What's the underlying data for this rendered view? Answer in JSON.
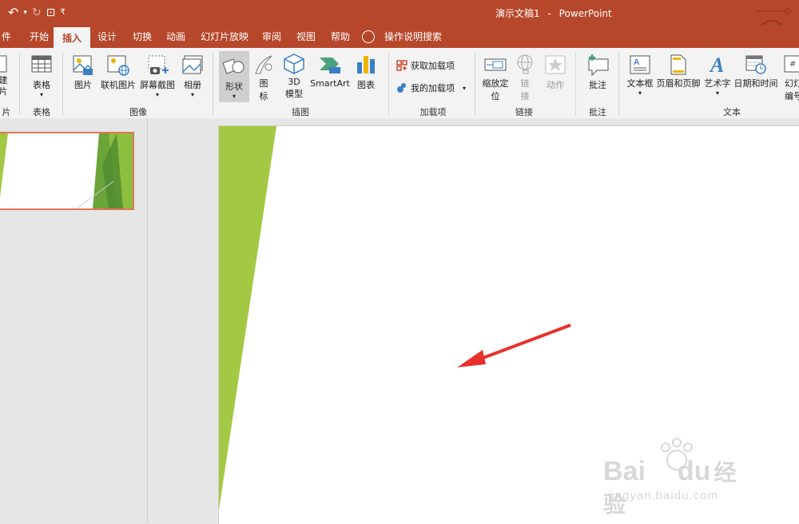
{
  "window": {
    "title": "演示文稿1",
    "app": "PowerPoint",
    "dash": "-"
  },
  "qat": {
    "undo": "↶",
    "undo_arrow": "▾",
    "redo": "↻",
    "present": "⊡",
    "customize": "₹"
  },
  "tabs": [
    {
      "label": "件"
    },
    {
      "label": "开始"
    },
    {
      "label": "插入"
    },
    {
      "label": "设计"
    },
    {
      "label": "切换"
    },
    {
      "label": "动画"
    },
    {
      "label": "幻灯片放映"
    },
    {
      "label": "审阅"
    },
    {
      "label": "视图"
    },
    {
      "label": "帮助"
    },
    {
      "label": "操作说明搜索"
    }
  ],
  "ribbon": {
    "g1": {
      "btn": "建\n片",
      "label": "片"
    },
    "g2": {
      "btn": "表格",
      "label": "表格"
    },
    "g3": {
      "label": "图像",
      "pictures": "图片",
      "online": "联机图片",
      "screenshot": "屏幕截图",
      "album": "相册"
    },
    "g4": {
      "label": "插图",
      "shapes": "形状",
      "icons_1": "图",
      "icons_2": "标",
      "model_1": "3D",
      "model_2": "模型",
      "smartart": "SmartArt",
      "chart": "图表"
    },
    "g5": {
      "label": "加载项",
      "get": "获取加载项",
      "my": "我的加载项"
    },
    "g6": {
      "label": "链接",
      "zoom_1": "缩放定",
      "zoom_2": "位",
      "link_1": "链",
      "link_2": "接",
      "action": "动作"
    },
    "g7": {
      "label": "批注",
      "comment": "批注"
    },
    "g8": {
      "label": "文本",
      "textbox": "文本框",
      "header": "页眉和页脚",
      "wordart": "艺术字",
      "datetime": "日期和时间",
      "slide_no_1": "幻灯",
      "slide_no_2": "编号"
    }
  },
  "watermark": {
    "brand": "Bai",
    "brand2": "du",
    "cn": "经验",
    "url": "jingyan.baidu.com"
  },
  "colors": {
    "accent": "#b7472a",
    "slide_green": "#a3c944",
    "arrow_red": "#e8312c"
  }
}
